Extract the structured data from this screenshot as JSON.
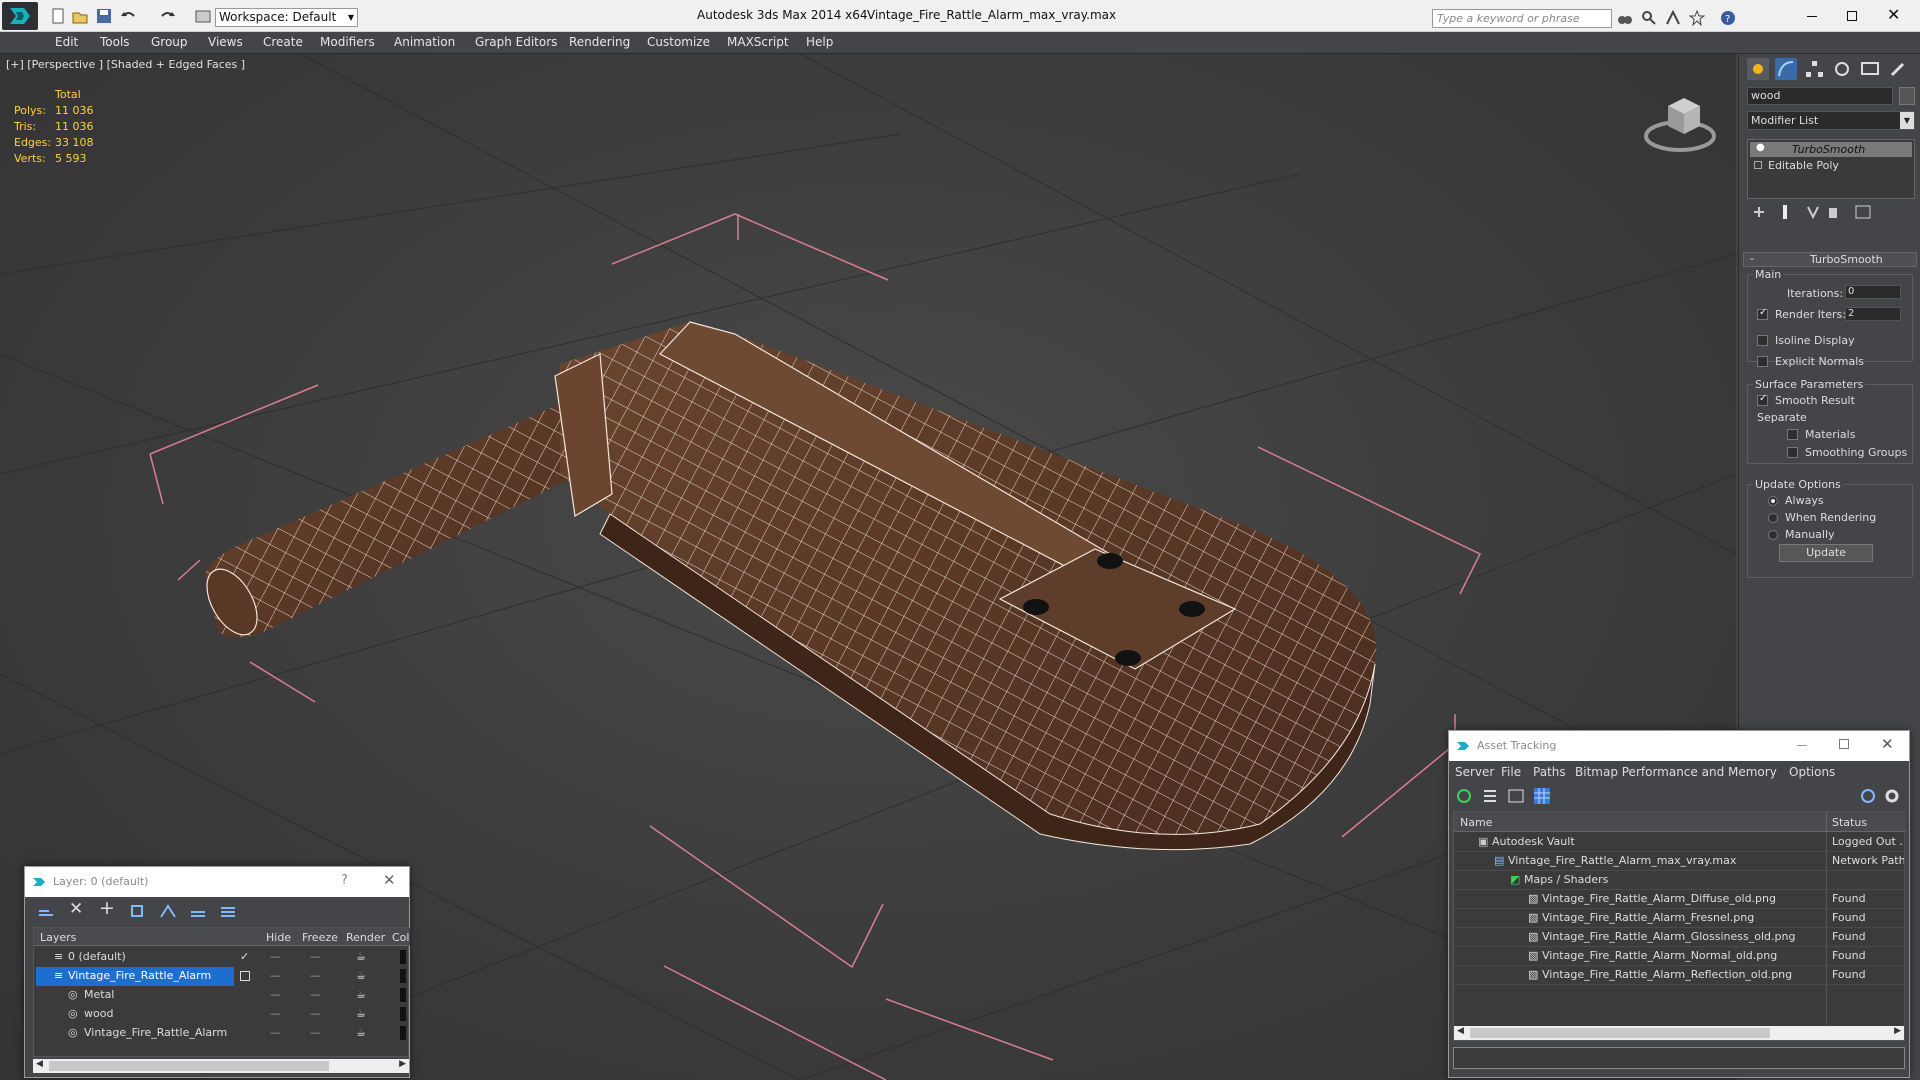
{
  "titlebar": {
    "workspace_label": "Workspace: Default",
    "app_title": "Autodesk 3ds Max  2014 x64",
    "file_title": "Vintage_Fire_Rattle_Alarm_max_vray.max",
    "search_placeholder": "Type a keyword or phrase"
  },
  "menu": [
    "Edit",
    "Tools",
    "Group",
    "Views",
    "Create",
    "Modifiers",
    "Animation",
    "Graph Editors",
    "Rendering",
    "Customize",
    "MAXScript",
    "Help"
  ],
  "viewport": {
    "label": "[+] [Perspective ] [Shaded + Edged Faces ]",
    "stats": {
      "header": "Total",
      "rows": [
        {
          "label": "Polys:",
          "value": "11 036"
        },
        {
          "label": "Tris:",
          "value": "11 036"
        },
        {
          "label": "Edges:",
          "value": "33 108"
        },
        {
          "label": "Verts:",
          "value": "5 593"
        }
      ]
    }
  },
  "command_panel": {
    "object_name": "wood",
    "modifier_list": "Modifier List",
    "stack": [
      "TurboSmooth",
      "Editable Poly"
    ],
    "rollout_title": "TurboSmooth",
    "main_label": "Main",
    "iterations_label": "Iterations:",
    "iterations_value": "0",
    "render_iters_label": "Render Iters:",
    "render_iters_value": "2",
    "isoline_label": "Isoline Display",
    "explicit_normals_label": "Explicit Normals",
    "surface_params_label": "Surface Parameters",
    "smooth_result_label": "Smooth Result",
    "separate_label": "Separate",
    "materials_label": "Materials",
    "smoothing_groups_label": "Smoothing Groups",
    "update_options_label": "Update Options",
    "always_label": "Always",
    "when_rendering_label": "When Rendering",
    "manually_label": "Manually",
    "update_button": "Update"
  },
  "layer_dialog": {
    "title": "Layer: 0 (default)",
    "help": "?",
    "columns": [
      "Layers",
      "Hide",
      "Freeze",
      "Render",
      "Col"
    ],
    "rows": [
      {
        "name": "0 (default)",
        "indent": 0
      },
      {
        "name": "Vintage_Fire_Rattle_Alarm",
        "indent": 0,
        "selected": true
      },
      {
        "name": "Metal",
        "indent": 1
      },
      {
        "name": "wood",
        "indent": 1
      },
      {
        "name": "Vintage_Fire_Rattle_Alarm",
        "indent": 1
      }
    ]
  },
  "asset_dialog": {
    "title": "Asset Tracking",
    "menu": [
      "Server",
      "File",
      "Paths",
      "Bitmap Performance and Memory",
      "Options"
    ],
    "columns": [
      "Name",
      "Status"
    ],
    "rows": [
      {
        "name": "Autodesk Vault",
        "status": "Logged Out ...",
        "indent": 0
      },
      {
        "name": "Vintage_Fire_Rattle_Alarm_max_vray.max",
        "status": "Network Path",
        "indent": 1
      },
      {
        "name": "Maps / Shaders",
        "status": "",
        "indent": 2
      },
      {
        "name": "Vintage_Fire_Rattle_Alarm_Diffuse_old.png",
        "status": "Found",
        "indent": 3
      },
      {
        "name": "Vintage_Fire_Rattle_Alarm_Fresnel.png",
        "status": "Found",
        "indent": 3
      },
      {
        "name": "Vintage_Fire_Rattle_Alarm_Glossiness_old.png",
        "status": "Found",
        "indent": 3
      },
      {
        "name": "Vintage_Fire_Rattle_Alarm_Normal_old.png",
        "status": "Found",
        "indent": 3
      },
      {
        "name": "Vintage_Fire_Rattle_Alarm_Reflection_old.png",
        "status": "Found",
        "indent": 3
      }
    ]
  },
  "colors": {
    "accent": "#3399ff",
    "stat_yellow": "#ffd23a",
    "selection": "#1e6ecf"
  }
}
